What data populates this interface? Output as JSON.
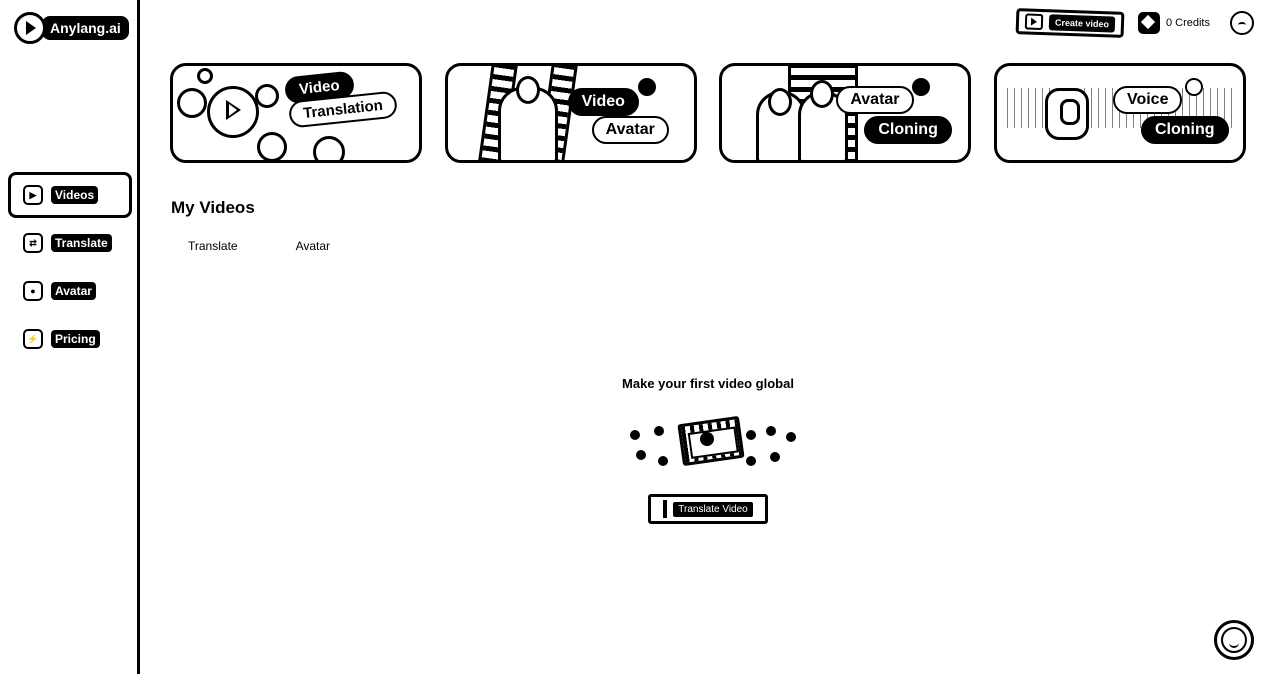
{
  "brand": {
    "name": "Anylang.ai"
  },
  "sidebar": {
    "items": [
      {
        "label": "Videos",
        "icon": "play-icon",
        "active": true
      },
      {
        "label": "Translate",
        "icon": "translate-icon",
        "active": false
      },
      {
        "label": "Avatar",
        "icon": "avatar-icon",
        "active": false
      },
      {
        "label": "Pricing",
        "icon": "bolt-icon",
        "active": false
      }
    ]
  },
  "header": {
    "create_label": "Create video",
    "credits": "0 Credits"
  },
  "cards": [
    {
      "line1": "Video",
      "line2": "Translation"
    },
    {
      "line1": "Video",
      "line2": "Avatar"
    },
    {
      "line1": "Avatar",
      "line2": "Cloning"
    },
    {
      "line1": "Voice",
      "line2": "Cloning"
    }
  ],
  "main": {
    "title": "My Videos",
    "tabs": [
      "Translate",
      "Avatar"
    ],
    "empty_title": "Make your first video global",
    "cta_label": "Translate Video"
  }
}
